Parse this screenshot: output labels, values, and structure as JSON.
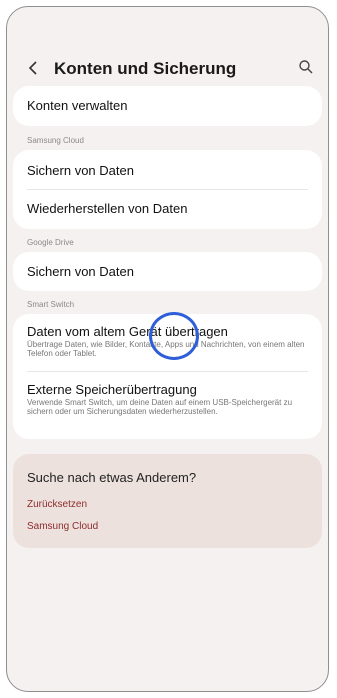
{
  "header": {
    "title": "Konten und Sicherung"
  },
  "cards": {
    "accounts": {
      "manage_label": "Konten verwalten"
    },
    "samsung_cloud": {
      "section_label": "Samsung Cloud",
      "backup_label": "Sichern von Daten",
      "restore_label": "Wiederherstellen von Daten"
    },
    "google_drive": {
      "section_label": "Google Drive",
      "backup_label": "Sichern von Daten"
    },
    "smart_switch": {
      "section_label": "Smart Switch",
      "transfer_label": "Daten vom altem Gerät übertragen",
      "transfer_desc": "Übertrage Daten, wie Bilder, Kontakte, Apps und Nachrichten, von einem alten Telefon oder Tablet.",
      "external_label": "Externe Speicherübertragung",
      "external_desc": "Verwende Smart Switch, um deine Daten auf einem USB-Speichergerät zu sichern oder um Sicherungsdaten wiederherzustellen."
    }
  },
  "suggestions": {
    "title": "Suche nach etwas Anderem?",
    "links": [
      "Zurücksetzen",
      "Samsung Cloud"
    ]
  },
  "highlight": {
    "color": "#2e5fd8"
  },
  "accent": {
    "link": "#8c2d2d",
    "suggest_bg": "#ede1dd"
  }
}
